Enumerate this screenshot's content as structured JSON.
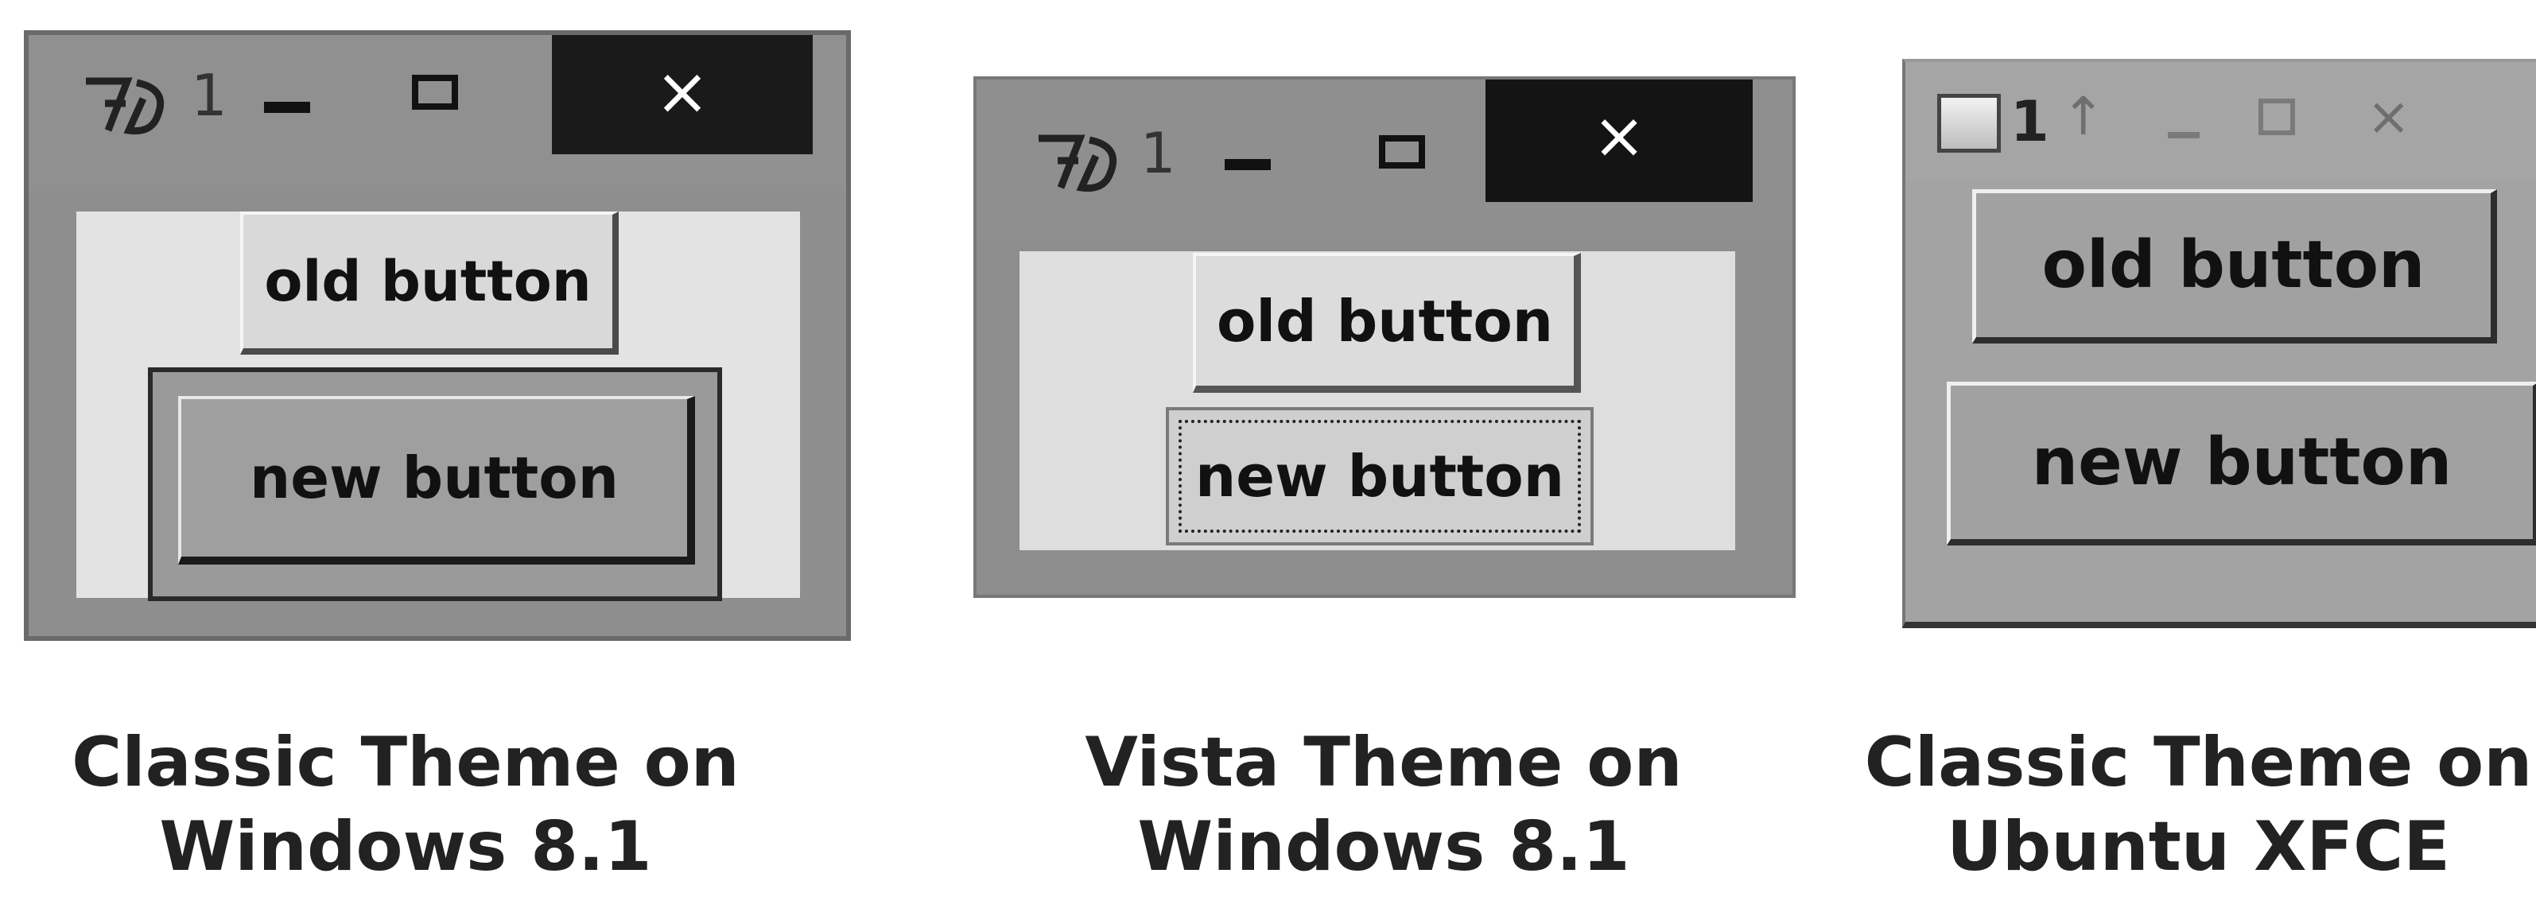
{
  "panels": [
    {
      "window": {
        "title": "1",
        "titlebar_icons": [
          "tk-feather-icon",
          "minimize-icon",
          "maximize-icon",
          "close-icon"
        ],
        "close_glyph": "×"
      },
      "old_button": "old button",
      "new_button": "new button",
      "caption_line1": "Classic Theme on",
      "caption_line2": "Windows 8.1"
    },
    {
      "window": {
        "title": "1",
        "titlebar_icons": [
          "tk-feather-icon",
          "minimize-icon",
          "maximize-icon",
          "close-icon"
        ],
        "close_glyph": "×"
      },
      "old_button": "old button",
      "new_button": "new button",
      "caption_line1": "Vista Theme on",
      "caption_line2": "Windows 8.1"
    },
    {
      "window": {
        "title": "1",
        "titlebar_icons": [
          "app-icon",
          "arrow-up-icon",
          "minimize-icon",
          "maximize-icon",
          "close-icon"
        ],
        "close_glyph": "×"
      },
      "old_button": "old button",
      "new_button": "new button",
      "caption_line1": "Classic Theme on",
      "caption_line2": "Ubuntu XFCE"
    }
  ]
}
